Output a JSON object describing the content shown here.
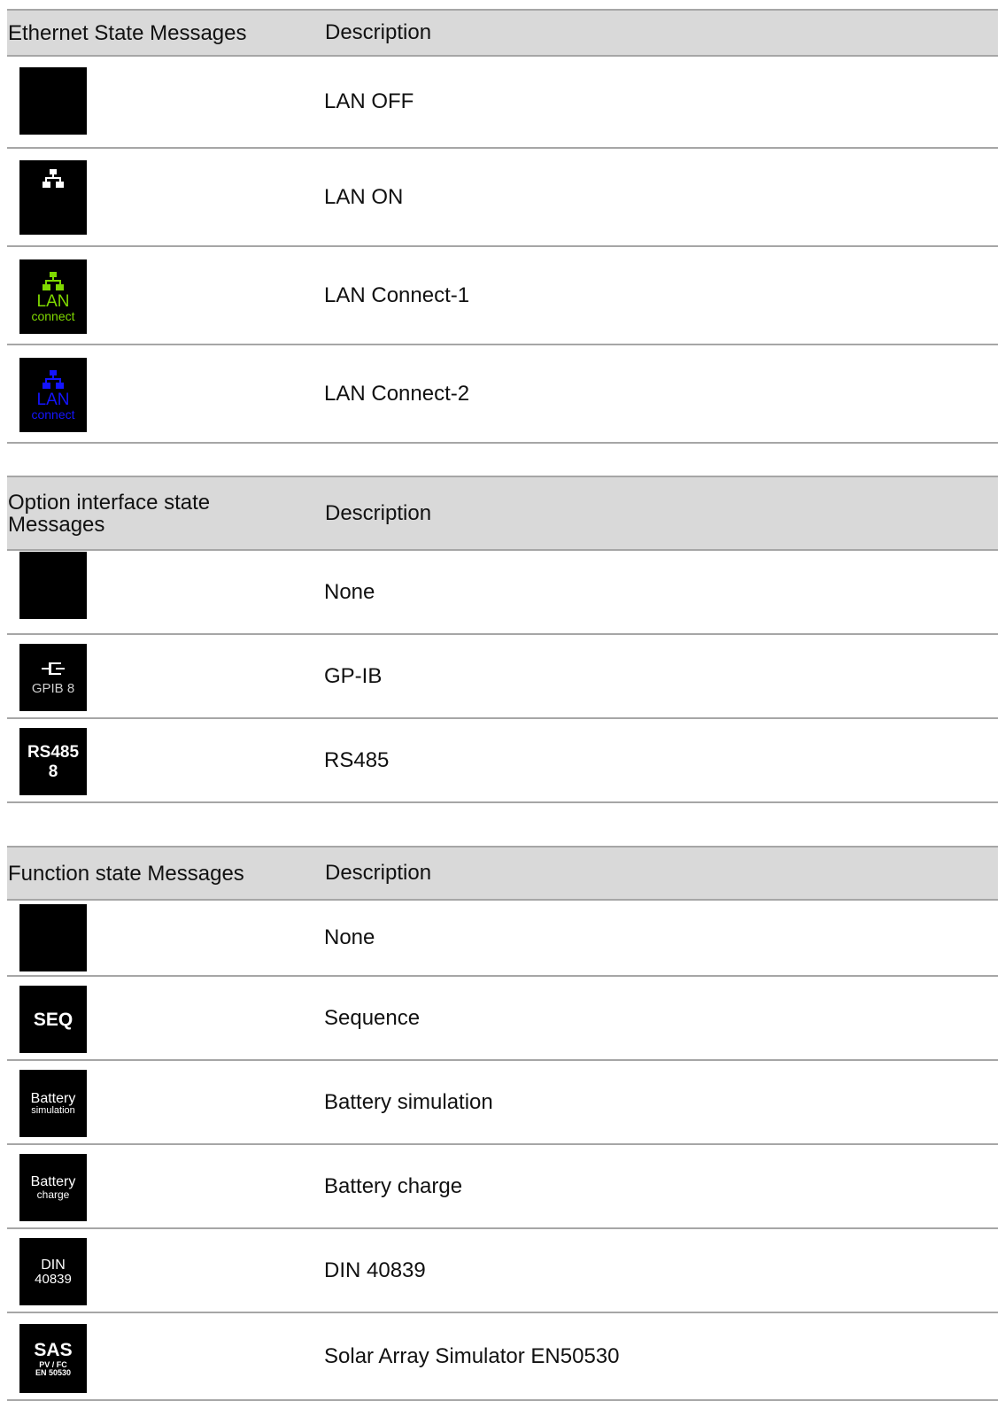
{
  "sections": [
    {
      "header": {
        "col1": "Ethernet State Messages",
        "col2": "Description"
      },
      "rows": [
        {
          "icon": "blank-icon",
          "description": "LAN OFF"
        },
        {
          "icon": "network-icon",
          "description": "LAN ON"
        },
        {
          "icon": "lan-connect-green-icon",
          "icon_text": "LAN",
          "icon_sub": "connect",
          "description": "LAN Connect-1"
        },
        {
          "icon": "lan-connect-blue-icon",
          "icon_text": "LAN",
          "icon_sub": "connect",
          "description": "LAN Connect-2"
        }
      ]
    },
    {
      "header": {
        "col1": "Option interface state Messages",
        "col2": "Description"
      },
      "rows": [
        {
          "icon": "blank-icon",
          "description": "None"
        },
        {
          "icon": "gpib-icon",
          "icon_text": "GPIB 8",
          "description": "GP-IB"
        },
        {
          "icon": "rs485-icon",
          "icon_text": "RS485",
          "icon_sub": "8",
          "description": "RS485"
        }
      ]
    },
    {
      "header": {
        "col1": "Function state Messages",
        "col2": "Description"
      },
      "rows": [
        {
          "icon": "blank-icon",
          "description": "None"
        },
        {
          "icon": "seq-icon",
          "icon_text": "SEQ",
          "description": "Sequence"
        },
        {
          "icon": "battery-simulation-icon",
          "icon_text": "Battery",
          "icon_sub": "simulation",
          "description": "Battery simulation"
        },
        {
          "icon": "battery-charge-icon",
          "icon_text": "Battery",
          "icon_sub": "charge",
          "description": "Battery charge"
        },
        {
          "icon": "din-icon",
          "icon_text": "DIN",
          "icon_sub": "40839",
          "description": "DIN 40839"
        },
        {
          "icon": "sas-icon",
          "icon_text": "SAS",
          "icon_sub": "PV / FC",
          "icon_sub2": "EN 50530",
          "description": "Solar Array Simulator EN50530"
        }
      ]
    }
  ],
  "colors": {
    "header_bg": "#d9d9d9",
    "rule": "#a6a6a6",
    "lan_green": "#7fd800",
    "lan_blue": "#1414ff"
  }
}
